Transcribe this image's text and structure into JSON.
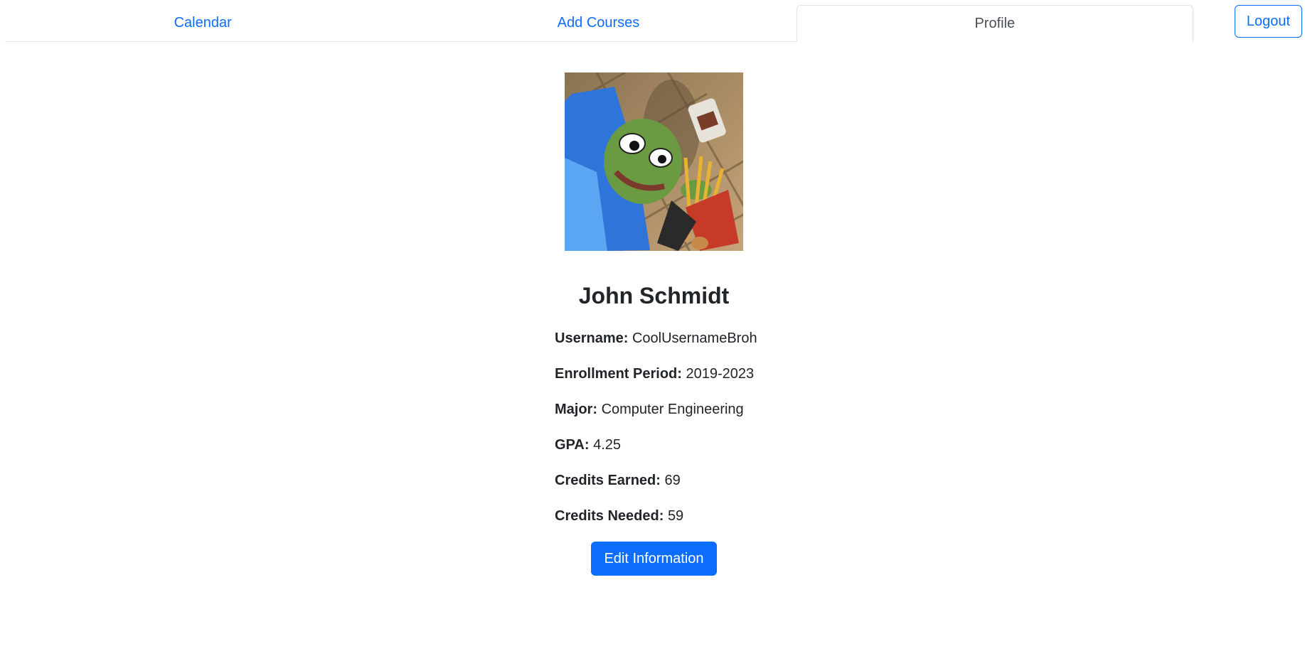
{
  "nav": {
    "tabs": [
      {
        "label": "Calendar",
        "active": false
      },
      {
        "label": "Add Courses",
        "active": false
      },
      {
        "label": "Profile",
        "active": true
      }
    ],
    "logout_label": "Logout"
  },
  "profile": {
    "avatar_icon": "profile-picture",
    "name": "John Schmidt",
    "fields": [
      {
        "label": "Username:",
        "value": "CoolUsernameBroh"
      },
      {
        "label": "Enrollment Period:",
        "value": "2019-2023"
      },
      {
        "label": "Major:",
        "value": "Computer Engineering"
      },
      {
        "label": "GPA:",
        "value": "4.25"
      },
      {
        "label": "Credits Earned:",
        "value": "69"
      },
      {
        "label": "Credits Needed:",
        "value": "59"
      }
    ],
    "edit_label": "Edit Information"
  },
  "colors": {
    "primary": "#0d6efd",
    "text": "#212529",
    "border": "#dee2e6"
  }
}
